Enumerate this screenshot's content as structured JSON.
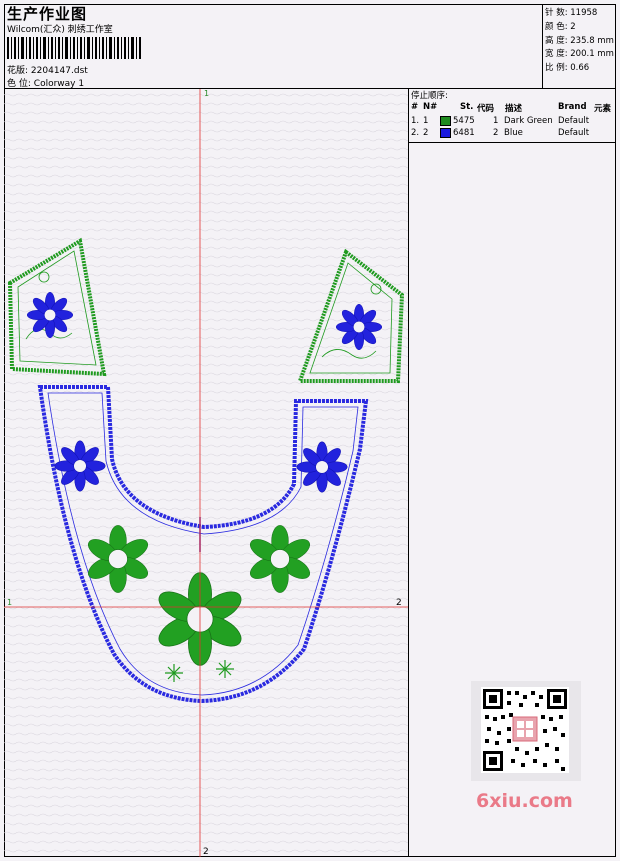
{
  "header": {
    "title": "生产作业图",
    "studio": "Wilcom(汇众) 刺绣工作室",
    "design_label": "花版:",
    "design_value": "2204147.dst",
    "colorway_label": "色 位:",
    "colorway_value": "Colorway 1"
  },
  "stats": {
    "stitches": "针 数: 11958",
    "colors": "颜 色: 2",
    "height": "高 度: 235.8 mm",
    "width": "宽 度: 200.1 mm",
    "scale": "比 例: 0.66"
  },
  "stop_sequence": {
    "title": "停止顺序:",
    "columns": [
      "#",
      "N#",
      "St.",
      "代码",
      "描述",
      "Brand",
      "元素"
    ],
    "rows": [
      {
        "idx": "1.",
        "n": "1",
        "color": "#1e8a1e",
        "stitches": "5475",
        "code": "1",
        "desc": "Dark Green",
        "brand": "Default"
      },
      {
        "idx": "2.",
        "n": "2",
        "color": "#1a1ae0",
        "stitches": "6481",
        "code": "2",
        "desc": "Blue",
        "brand": "Default"
      }
    ]
  },
  "axes": {
    "top": "1",
    "left": "1",
    "right": "2",
    "bottom": "2"
  },
  "colors": {
    "green": "#1f9a1f",
    "blue": "#2222dd",
    "axis": "#e03030"
  },
  "watermark": "6xiu.com"
}
